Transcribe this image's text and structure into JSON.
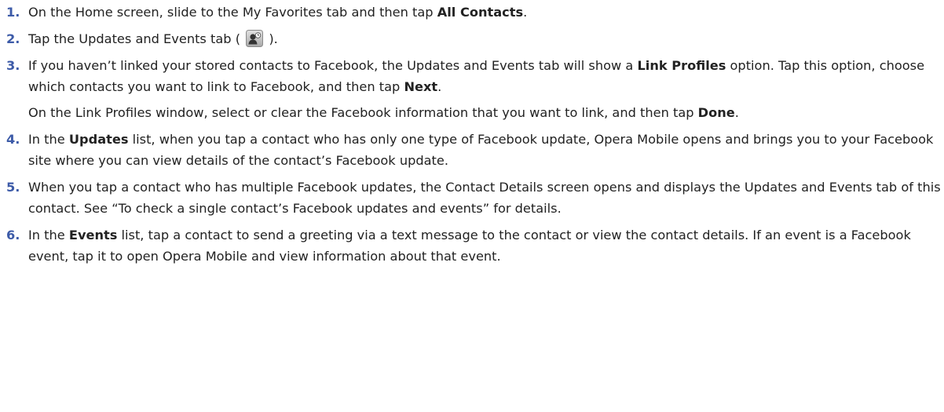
{
  "steps": [
    {
      "num": "1.",
      "t1": "On the Home screen, slide to the My Favorites tab and then tap ",
      "b1": "All Contacts",
      "t2": "."
    },
    {
      "num": "2.",
      "t1": "Tap the Updates and Events tab ( ",
      "icon": "updates-events-contact-icon",
      "t2": " )."
    },
    {
      "num": "3.",
      "t1": "If you haven’t linked your stored contacts to Facebook, the Updates and Events tab will show a ",
      "b1": "Link Profiles",
      "t2": " option. Tap this option, choose which contacts you want to link to Facebook, and then tap ",
      "b2": "Next",
      "t3": ".",
      "p2_t1": "On the Link Profiles window, select or clear the Facebook information that you want to link, and then tap ",
      "p2_b1": "Done",
      "p2_t2": "."
    },
    {
      "num": "4.",
      "t1": "In the ",
      "b1": "Updates",
      "t2": " list, when you tap a contact who has only one type of Facebook update, Opera Mobile opens and brings you to your Facebook site where you can view details of the contact’s Facebook update."
    },
    {
      "num": "5.",
      "t1": "When you tap a contact who has multiple Facebook updates, the Contact Details screen opens and displays the Updates and Events tab of this contact. See “To check a single contact’s Facebook updates and events” for details."
    },
    {
      "num": "6.",
      "t1": "In the ",
      "b1": "Events",
      "t2": " list, tap a contact to send a greeting via a text message to the contact or view the contact details. If an event is a Facebook event, tap it to open Opera Mobile and view information about that event."
    }
  ],
  "colors": {
    "step_number": "#3d5ba8",
    "body_text": "#222222"
  }
}
